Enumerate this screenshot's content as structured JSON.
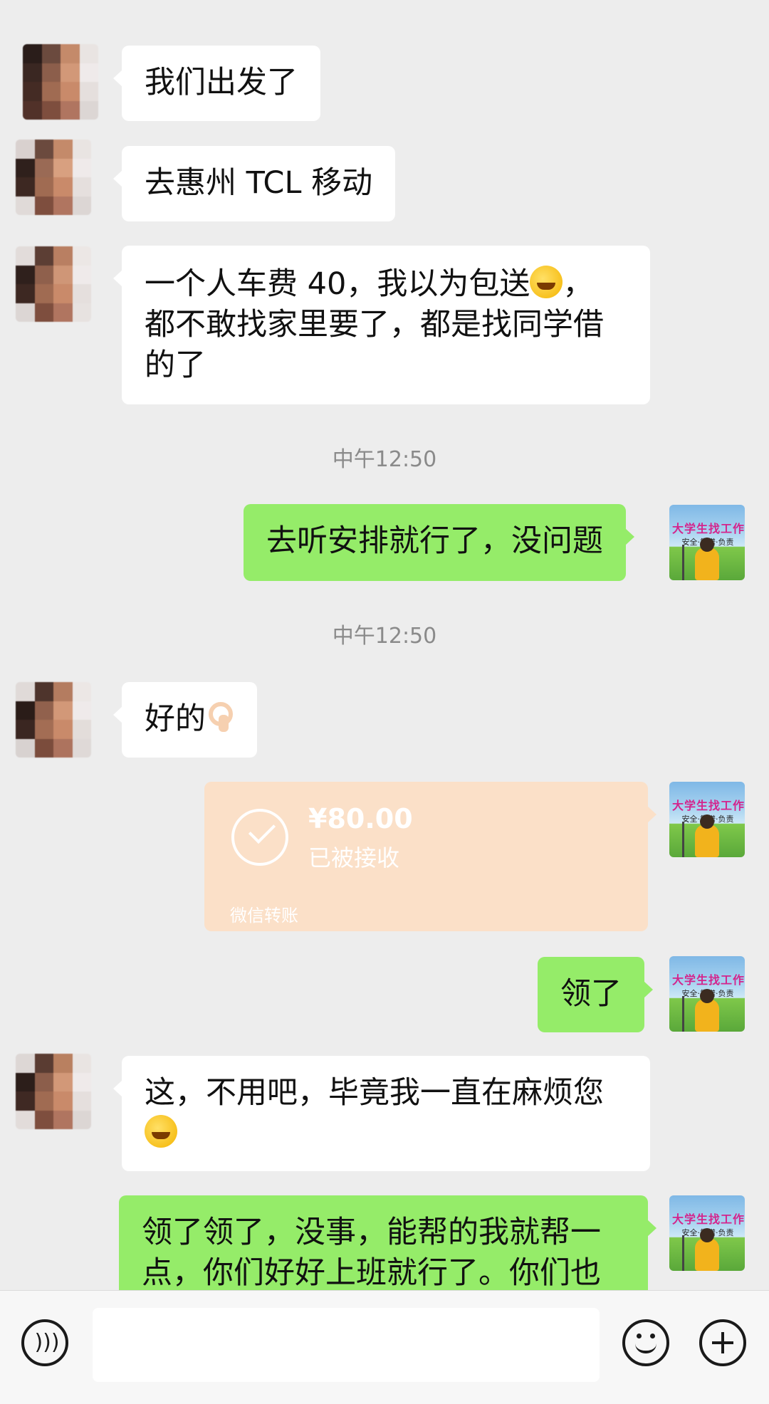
{
  "messages": [
    {
      "from": "them",
      "text": "我们出发了"
    },
    {
      "from": "them",
      "text": "去惠州 TCL 移动"
    },
    {
      "from": "them",
      "line1": "一个人车费 40，我以为包送",
      "line1_tail": "，",
      "line2": "都不敢找家里要了，都是找同学借",
      "line3": "的了"
    },
    {
      "timestamp": "中午12:50"
    },
    {
      "from": "me",
      "text": "去听安排就行了，没问题"
    },
    {
      "timestamp": "中午12:50"
    },
    {
      "from": "them",
      "text": "好的"
    },
    {
      "from": "me",
      "transfer": {
        "amount": "¥80.00",
        "status": "已被接收",
        "label": "微信转账"
      }
    },
    {
      "from": "me",
      "text": "领了"
    },
    {
      "from": "them",
      "line1": "这，不用吧，毕竟我一直在麻烦您"
    },
    {
      "from": "me",
      "line1": "领了领了，没事，能帮的我就帮一",
      "line2": "点，你们好好上班就行了。你们也"
    }
  ],
  "my_avatar": {
    "title": "大学生找工作",
    "subtitle": "安全·靠谱·负责"
  },
  "icons": {
    "voice": "voice-icon",
    "emoji": "emoji-icon",
    "more": "plus-icon",
    "cry_laugh": "face-with-tears-of-joy-icon",
    "ok_hand": "ok-hand-icon"
  },
  "colors": {
    "background": "#ededed",
    "outgoing_bubble": "#95ec69",
    "incoming_bubble": "#ffffff",
    "transfer_card": "#fbe0c8"
  }
}
